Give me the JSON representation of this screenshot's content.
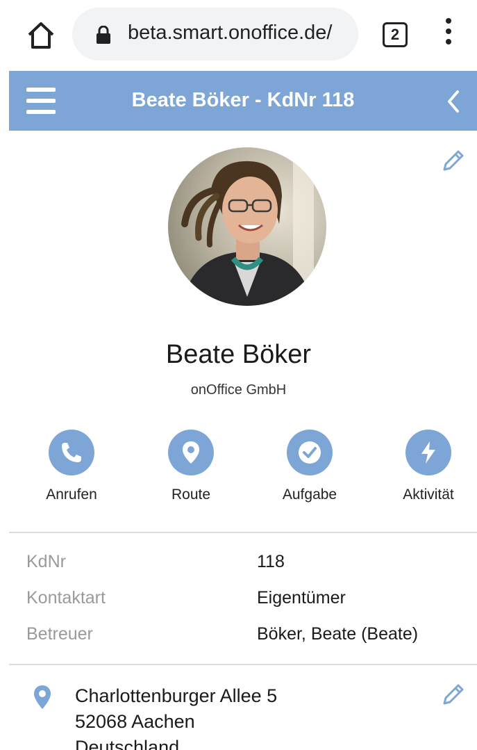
{
  "browser": {
    "url": "beta.smart.onoffice.de/",
    "tab_count": "2"
  },
  "header": {
    "title": "Beate Böker - KdNr 118"
  },
  "profile": {
    "name": "Beate Böker",
    "company": "onOffice GmbH"
  },
  "actions": [
    {
      "label": "Anrufen",
      "icon": "phone-icon"
    },
    {
      "label": "Route",
      "icon": "location-pin-icon"
    },
    {
      "label": "Aufgabe",
      "icon": "check-circle-icon"
    },
    {
      "label": "Aktivität",
      "icon": "lightning-icon"
    }
  ],
  "details": [
    {
      "label": "KdNr",
      "value": "118"
    },
    {
      "label": "Kontaktart",
      "value": "Eigentümer"
    },
    {
      "label": "Betreuer",
      "value": "Böker, Beate (Beate)"
    }
  ],
  "address": {
    "street": "Charlottenburger Allee 5",
    "city": "52068 Aachen",
    "country": "Deutschland"
  },
  "colors": {
    "accent": "#7da6d6",
    "browser_pill": "#f1f3f4"
  }
}
